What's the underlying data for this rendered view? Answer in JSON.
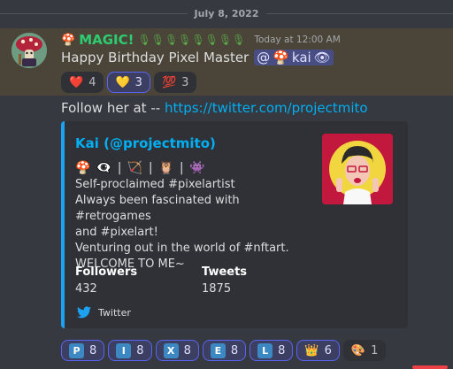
{
  "date_divider": "July 8, 2022",
  "message": {
    "username": "MAGIC!",
    "leaf_glyphs": "🎙🎙🎙🎙🎙🎙🎙🎙",
    "timestamp": "Today at 12:00 AM",
    "text": "Happy Birthday Pixel Master",
    "mention_prefix": "@",
    "mention_name": "kai",
    "reactions": [
      {
        "emoji": "❤️",
        "count": "4",
        "me": false
      },
      {
        "emoji": "💛",
        "count": "3",
        "me": true
      },
      {
        "emoji": "💯",
        "count": "3",
        "me": false
      }
    ]
  },
  "follow": {
    "text": "Follow her at -- ",
    "link": "https://twitter.com/projectmito"
  },
  "embed": {
    "accent_color": "#1da1f2",
    "author": "Kai (@projectmito)",
    "emoji_row": "🍄 👁️‍🗨️ | 🏹 | 🦉 | 👾",
    "description_lines": [
      "Self-proclaimed #pixelartist",
      "Always been fascinated with #retrogames",
      "and #pixelart!",
      "Venturing out in the world of #nftart.",
      "WELCOME TO ME~"
    ],
    "fields": [
      {
        "name": "Followers",
        "value": "432"
      },
      {
        "name": "Tweets",
        "value": "1875"
      }
    ],
    "footer": "Twitter"
  },
  "reactions_bottom": [
    {
      "emoji": "P",
      "count": "8",
      "type": "letter"
    },
    {
      "emoji": "I",
      "count": "8",
      "type": "letter"
    },
    {
      "emoji": "X",
      "count": "8",
      "type": "letter"
    },
    {
      "emoji": "E",
      "count": "8",
      "type": "letter"
    },
    {
      "emoji": "L",
      "count": "8",
      "type": "letter"
    },
    {
      "emoji": "👑",
      "count": "6",
      "type": "emoji"
    },
    {
      "emoji": "🎨",
      "count": "1",
      "type": "emoji"
    }
  ],
  "colors": {
    "background": "#36393f",
    "highlight": "#4a4538",
    "username": "#2ecc71",
    "link": "#00aff4",
    "reaction_me_border": "#5865f2"
  }
}
